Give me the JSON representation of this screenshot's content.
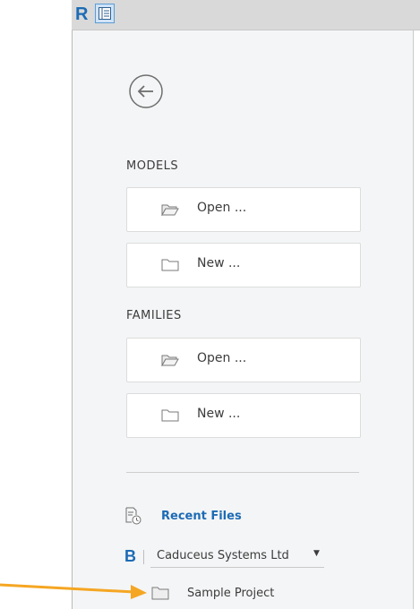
{
  "app": {
    "logo_letter": "R"
  },
  "models": {
    "section_label": "MODELS",
    "open_label": "Open ...",
    "new_label": "New ..."
  },
  "families": {
    "section_label": "FAMILIES",
    "open_label": "Open ...",
    "new_label": "New ..."
  },
  "recent": {
    "label": "Recent Files"
  },
  "hub": {
    "logo_letter": "B",
    "company": "Caduceus Systems Ltd"
  },
  "projects": [
    {
      "label": "Sample Project"
    }
  ],
  "colors": {
    "accent": "#1d6bb5",
    "panel_bg": "#f4f5f6",
    "card_border": "#dcdcdc",
    "arrow": "#f5a623"
  }
}
